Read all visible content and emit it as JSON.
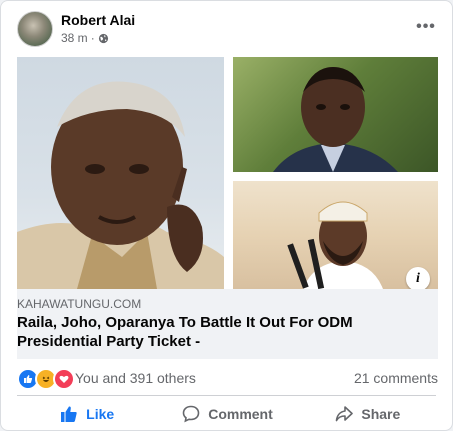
{
  "post": {
    "author": "Robert Alai",
    "time": "38 m",
    "separator": "·",
    "more_label": "•••"
  },
  "link": {
    "domain": "KAHAWATUNGU.COM",
    "headline": "Raila, Joho, Oparanya To Battle It Out For ODM Presidential Party Ticket -",
    "info_label": "i"
  },
  "stats": {
    "reactions_text": "You and 391 others",
    "comments_text": "21 comments"
  },
  "actions": {
    "like": "Like",
    "comment": "Comment",
    "share": "Share"
  },
  "colors": {
    "accent": "#1877f2",
    "muted_text": "#65676b",
    "link_bg": "#f0f2f5"
  }
}
